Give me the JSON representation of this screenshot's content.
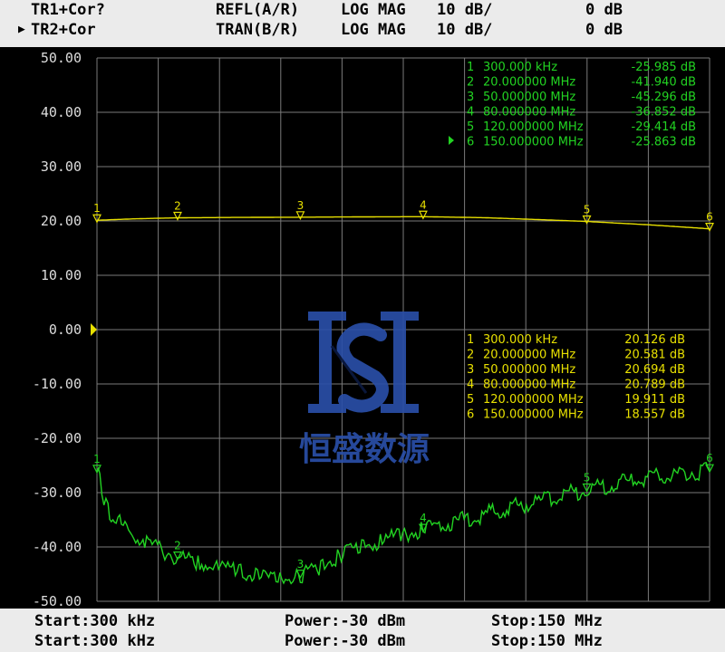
{
  "header": {
    "line1": {
      "trace": "TR1+Cor?",
      "meas": "REFL(A/R)",
      "format": "LOG MAG",
      "scale": "10 dB/",
      "ref": "0 dB"
    },
    "line2": {
      "trace": "TR2+Cor",
      "meas": "TRAN(B/R)",
      "format": "LOG MAG",
      "scale": "10 dB/",
      "ref": "0 dB"
    },
    "active_indicator": "▶"
  },
  "footer": {
    "line1": {
      "start": "Start:300 kHz",
      "power": "Power:-30 dBm",
      "stop": "Stop:150 MHz"
    },
    "line2": {
      "start": "Start:300 kHz",
      "power": "Power:-30 dBm",
      "stop": "Stop:150 MHz"
    }
  },
  "watermark": {
    "text": "恒盛数源",
    "logo": "hs-monogram-logo"
  },
  "colors": {
    "screen_bg": "#000000",
    "grid": "#7a7a7a",
    "trace_refl": "#22d322",
    "trace_tran": "#e8e000",
    "watermark": "#2a4fa8"
  },
  "marker_table_refl": [
    {
      "num": "1",
      "freq": "300.000 kHz",
      "value": "-25.985 dB"
    },
    {
      "num": "2",
      "freq": "20.000000 MHz",
      "value": "-41.940 dB"
    },
    {
      "num": "3",
      "freq": "50.000000 MHz",
      "value": "-45.296 dB"
    },
    {
      "num": "4",
      "freq": "80.000000 MHz",
      "value": "-36.852 dB"
    },
    {
      "num": "5",
      "freq": "120.000000 MHz",
      "value": "-29.414 dB"
    },
    {
      "num": "6",
      "freq": "150.000000 MHz",
      "value": "-25.863 dB"
    }
  ],
  "marker_table_tran": [
    {
      "num": "1",
      "freq": "300.000 kHz",
      "value": "20.126 dB"
    },
    {
      "num": "2",
      "freq": "20.000000 MHz",
      "value": "20.581 dB"
    },
    {
      "num": "3",
      "freq": "50.000000 MHz",
      "value": "20.694 dB"
    },
    {
      "num": "4",
      "freq": "80.000000 MHz",
      "value": "20.789 dB"
    },
    {
      "num": "5",
      "freq": "120.000000 MHz",
      "value": "19.911 dB"
    },
    {
      "num": "6",
      "freq": "150.000000 MHz",
      "value": "18.557 dB"
    }
  ],
  "chart_data": {
    "type": "line",
    "x_unit": "MHz",
    "xlim": [
      0.3,
      150
    ],
    "ylim": [
      -50,
      50
    ],
    "y_ticks": [
      "50.00",
      "40.00",
      "30.00",
      "20.00",
      "10.00",
      "0.00",
      "-10.00",
      "-20.00",
      "-30.00",
      "-40.00",
      "-50.00"
    ],
    "grid": true,
    "reference_level": 0,
    "series": [
      {
        "name": "TR1",
        "color": "#22d322",
        "points": [
          [
            0.3,
            -25.985
          ],
          [
            1,
            -28
          ],
          [
            2,
            -31
          ],
          [
            3,
            -33
          ],
          [
            5,
            -35
          ],
          [
            8,
            -37
          ],
          [
            12,
            -39
          ],
          [
            16,
            -40.5
          ],
          [
            20,
            -41.94
          ],
          [
            25,
            -43
          ],
          [
            30,
            -44
          ],
          [
            35,
            -44.5
          ],
          [
            40,
            -45.5
          ],
          [
            45,
            -46
          ],
          [
            50,
            -45.296
          ],
          [
            55,
            -43.5
          ],
          [
            60,
            -41.5
          ],
          [
            65,
            -40
          ],
          [
            70,
            -38.8
          ],
          [
            75,
            -37.8
          ],
          [
            80,
            -36.852
          ],
          [
            90,
            -35
          ],
          [
            100,
            -33
          ],
          [
            110,
            -31.2
          ],
          [
            120,
            -29.414
          ],
          [
            130,
            -28
          ],
          [
            140,
            -26.8
          ],
          [
            150,
            -25.863
          ]
        ],
        "markers": [
          [
            0.3,
            -25.985
          ],
          [
            20,
            -41.94
          ],
          [
            50,
            -45.296
          ],
          [
            80,
            -36.852
          ],
          [
            120,
            -29.414
          ],
          [
            150,
            -25.863
          ]
        ]
      },
      {
        "name": "TR2",
        "color": "#e8e000",
        "points": [
          [
            0.3,
            20.126
          ],
          [
            10,
            20.4
          ],
          [
            20,
            20.581
          ],
          [
            35,
            20.65
          ],
          [
            50,
            20.694
          ],
          [
            65,
            20.75
          ],
          [
            80,
            20.789
          ],
          [
            95,
            20.6
          ],
          [
            110,
            20.2
          ],
          [
            120,
            19.911
          ],
          [
            135,
            19.3
          ],
          [
            150,
            18.557
          ]
        ],
        "markers": [
          [
            0.3,
            20.126
          ],
          [
            20,
            20.581
          ],
          [
            50,
            20.694
          ],
          [
            80,
            20.789
          ],
          [
            120,
            19.911
          ],
          [
            150,
            18.557
          ]
        ]
      }
    ]
  }
}
